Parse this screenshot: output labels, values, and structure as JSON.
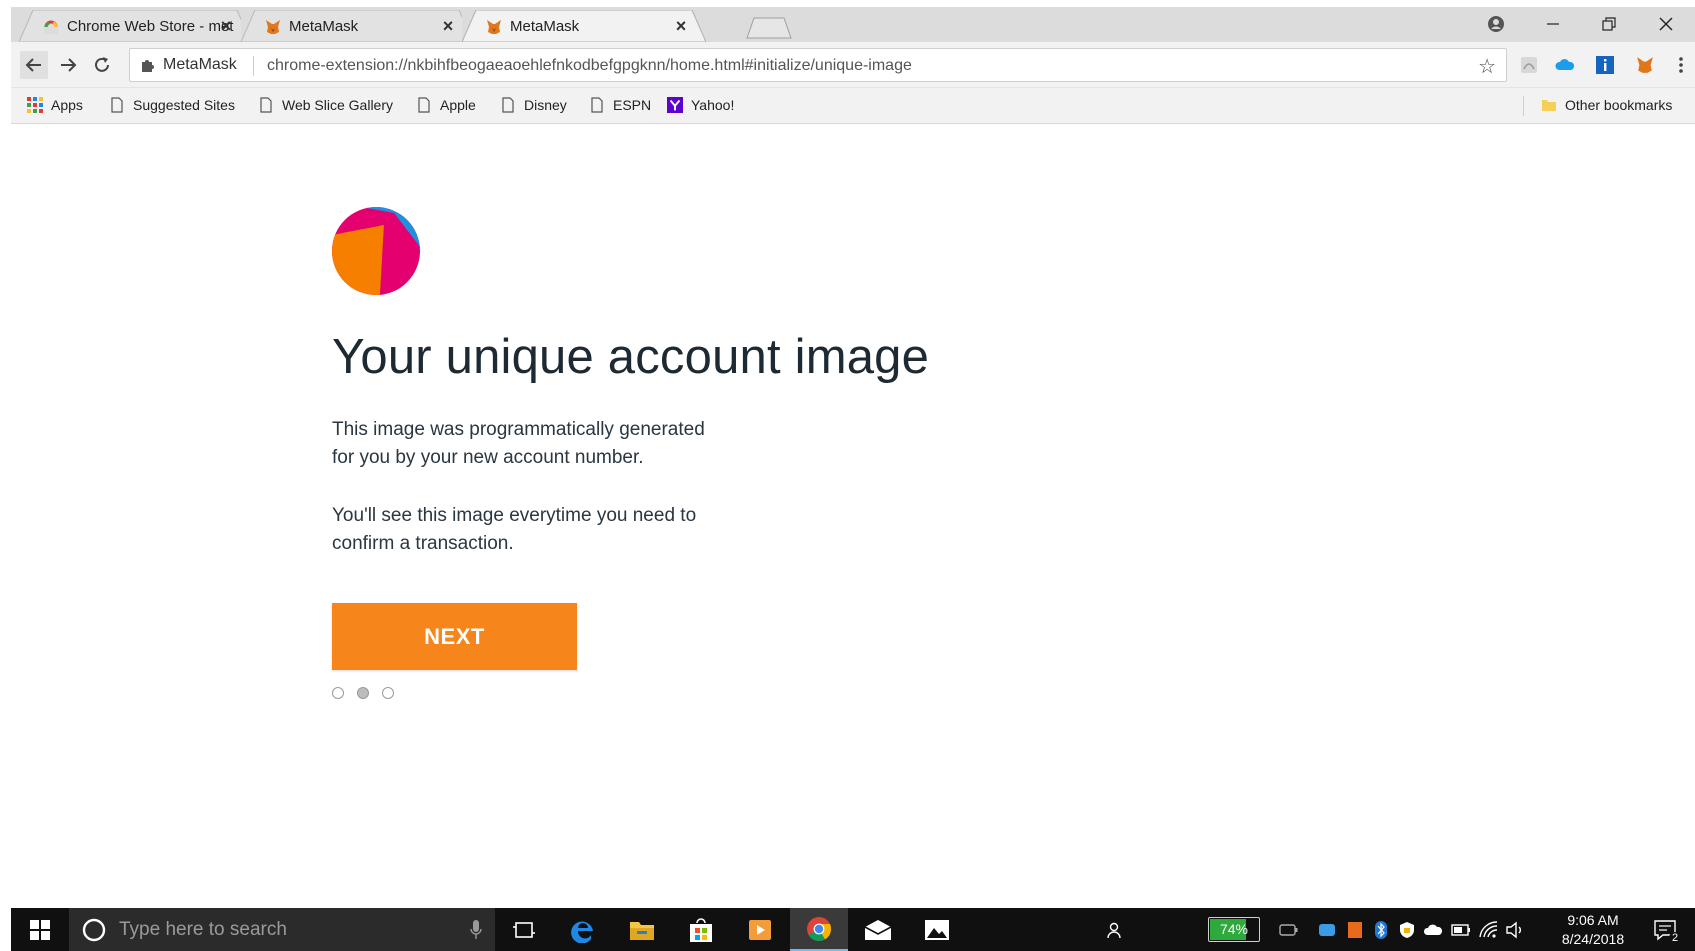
{
  "browser": {
    "tabs": [
      {
        "title": "Chrome Web Store - met",
        "favicon": "chrome-web-store-icon",
        "active": false
      },
      {
        "title": "MetaMask",
        "favicon": "metamask-fox-icon",
        "active": false
      },
      {
        "title": "MetaMask",
        "favicon": "metamask-fox-icon",
        "active": true
      }
    ],
    "omnibox": {
      "site_label": "MetaMask",
      "url": "chrome-extension://nkbihfbeogaeaoehlefnkodbefgpgknn/home.html#initialize/unique-image"
    },
    "bookmarks": [
      {
        "label": "Apps",
        "icon": "apps-grid-icon"
      },
      {
        "label": "Suggested Sites",
        "icon": "page-icon"
      },
      {
        "label": "Web Slice Gallery",
        "icon": "page-icon"
      },
      {
        "label": "Apple",
        "icon": "page-icon"
      },
      {
        "label": "Disney",
        "icon": "page-icon"
      },
      {
        "label": "ESPN",
        "icon": "page-icon"
      },
      {
        "label": "Yahoo!",
        "icon": "yahoo-icon"
      }
    ],
    "other_bookmarks": "Other bookmarks"
  },
  "page": {
    "heading": "Your unique account image",
    "paragraph_1_line_1": "This image was programmatically generated",
    "paragraph_1_line_2": "for you by your new account number.",
    "paragraph_2_line_1": "You'll see this image everytime you need to",
    "paragraph_2_line_2": "confirm a transaction.",
    "next_button": "NEXT",
    "steps_total": 3,
    "steps_current": 2,
    "accent_color": "#f6851b"
  },
  "taskbar": {
    "search_placeholder": "Type here to search",
    "battery_percent": "74%",
    "battery_level": 0.74,
    "clock_time": "9:06 AM",
    "clock_date": "8/24/2018",
    "notification_count": "2"
  }
}
